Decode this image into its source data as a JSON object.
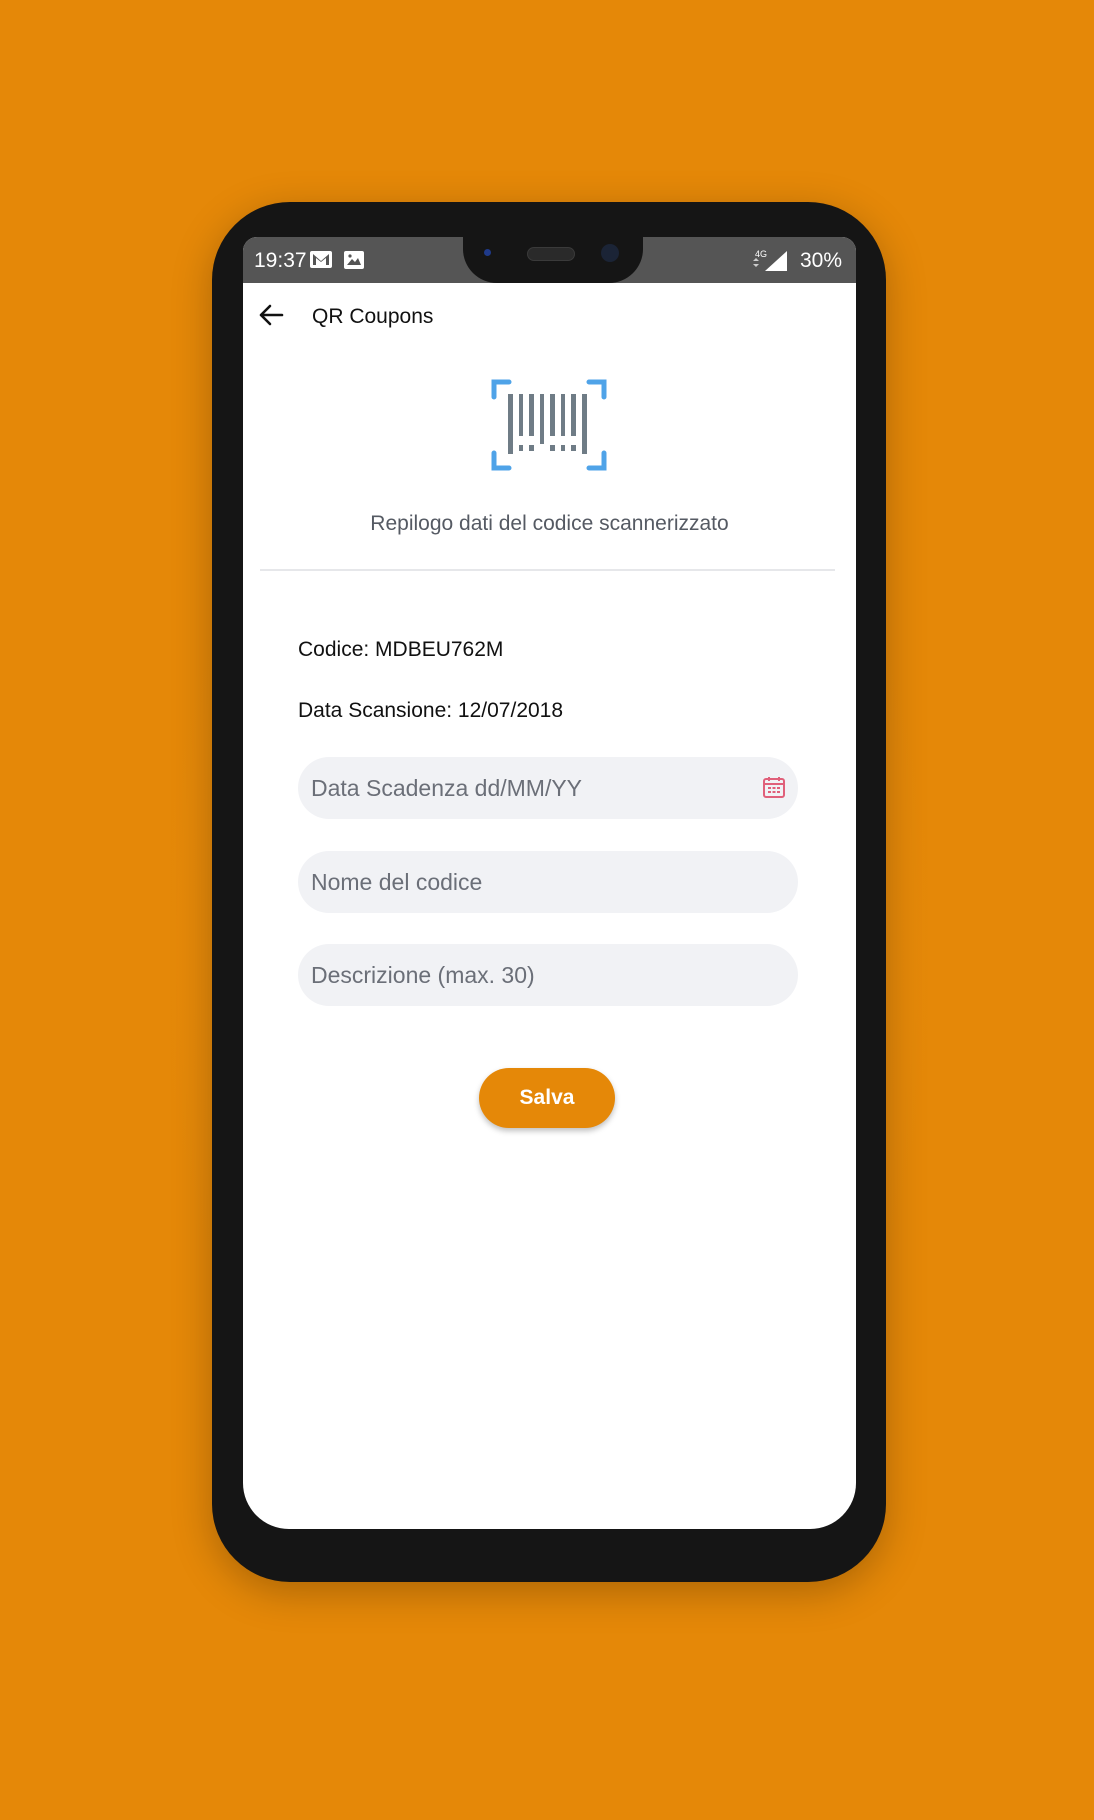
{
  "status_bar": {
    "time": "19:37",
    "network": "4G",
    "battery": "30%"
  },
  "app_bar": {
    "title": "QR Coupons"
  },
  "summary": {
    "heading": "Repilogo dati del codice scannerizzato"
  },
  "details": {
    "code": "Codice: MDBEU762M",
    "scan_date": "Data Scansione: 12/07/2018"
  },
  "form": {
    "expiry_placeholder": "Data Scadenza dd/MM/YY",
    "name_placeholder": "Nome del codice",
    "description_placeholder": "Descrizione (max. 30)",
    "save_label": "Salva"
  },
  "colors": {
    "accent": "#E58808",
    "barcode_bracket": "#4FA3E8",
    "barcode_bars": "#6F7C86",
    "calendar_icon": "#E0607A"
  }
}
